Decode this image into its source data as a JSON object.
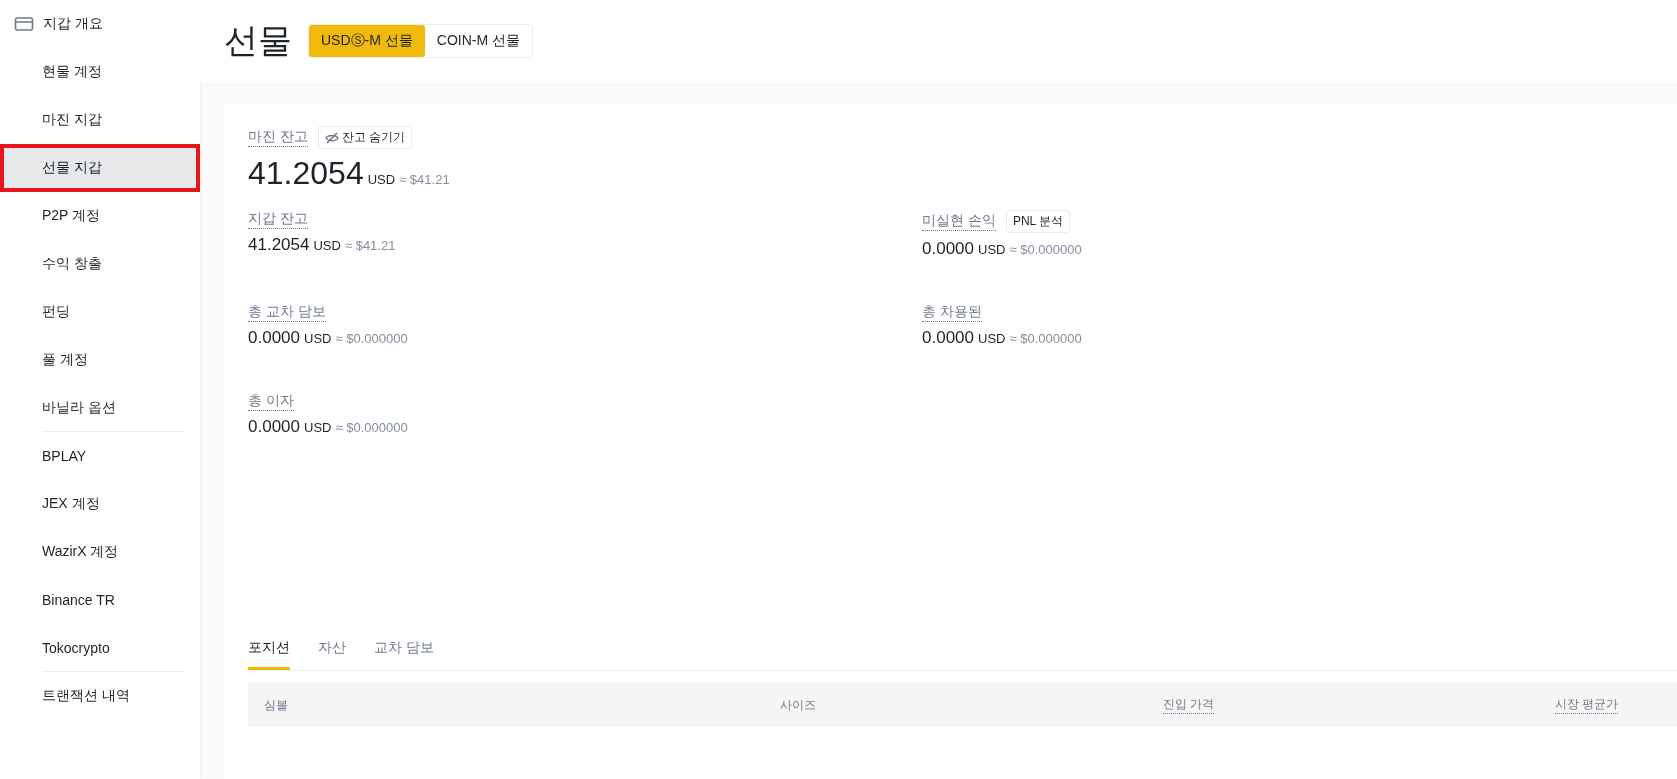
{
  "sidebar": {
    "items": [
      {
        "label": "지갑 개요",
        "kind": "overview",
        "selected": false,
        "divider_after": false
      },
      {
        "label": "현물 계정",
        "kind": "item",
        "selected": false,
        "divider_after": false
      },
      {
        "label": "마진 지갑",
        "kind": "item",
        "selected": false,
        "divider_after": false
      },
      {
        "label": "선물 지갑",
        "kind": "item",
        "selected": true,
        "highlighted": true,
        "divider_after": false
      },
      {
        "label": "P2P 계정",
        "kind": "item",
        "selected": false,
        "divider_after": false
      },
      {
        "label": "수익 창출",
        "kind": "item",
        "selected": false,
        "divider_after": false
      },
      {
        "label": "펀딩",
        "kind": "item",
        "selected": false,
        "divider_after": false
      },
      {
        "label": "풀 계정",
        "kind": "item",
        "selected": false,
        "divider_after": false
      },
      {
        "label": "바닐라 옵션",
        "kind": "item",
        "selected": false,
        "divider_after": true
      },
      {
        "label": "BPLAY",
        "kind": "item",
        "selected": false,
        "divider_after": false
      },
      {
        "label": "JEX 계정",
        "kind": "item",
        "selected": false,
        "divider_after": false
      },
      {
        "label": "WazirX 계정",
        "kind": "item",
        "selected": false,
        "divider_after": false
      },
      {
        "label": "Binance TR",
        "kind": "item",
        "selected": false,
        "divider_after": false
      },
      {
        "label": "Tokocrypto",
        "kind": "item",
        "selected": false,
        "divider_after": true
      },
      {
        "label": "트랜잭션 내역",
        "kind": "item",
        "selected": false,
        "divider_after": false
      }
    ]
  },
  "header": {
    "title": "선물",
    "toggle": [
      {
        "label": "USDⓈ-M 선물",
        "selected": true
      },
      {
        "label": "COIN-M 선물",
        "selected": false
      }
    ]
  },
  "balance": {
    "label": "마진 잔고",
    "hide_button": "잔고 숨기기",
    "value": "41.2054",
    "unit": "USD",
    "approx": "≈ $41.21"
  },
  "stats": [
    {
      "label": "지갑 잔고",
      "value": "41.2054",
      "unit": "USD",
      "approx": "≈ $41.21"
    },
    {
      "label": "미실현 손익",
      "button": "PNL 분석",
      "value": "0.0000",
      "unit": "USD",
      "approx": "≈ $0.000000"
    },
    {
      "label": "총 교차 담보",
      "value": "0.0000",
      "unit": "USD",
      "approx": "≈ $0.000000"
    },
    {
      "label": "총 차용된",
      "value": "0.0000",
      "unit": "USD",
      "approx": "≈ $0.000000"
    },
    {
      "label": "총 이자",
      "value": "0.0000",
      "unit": "USD",
      "approx": "≈ $0.000000"
    }
  ],
  "tabs": [
    {
      "label": "포지션",
      "selected": true
    },
    {
      "label": "자산",
      "selected": false
    },
    {
      "label": "교차 담보",
      "selected": false
    }
  ],
  "table": {
    "columns": [
      {
        "label": "심볼",
        "dotted": false
      },
      {
        "label": "사이즈",
        "dotted": false
      },
      {
        "label": "진입 가격",
        "dotted": true
      },
      {
        "label": "시장 평균가",
        "dotted": true
      }
    ]
  }
}
